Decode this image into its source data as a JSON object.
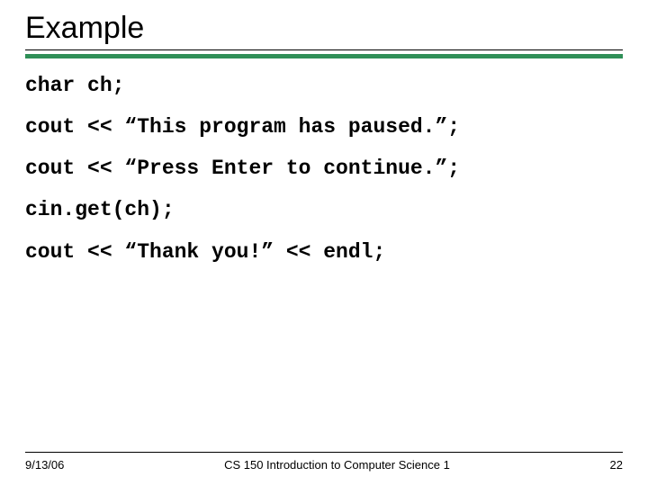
{
  "slide": {
    "title": "Example",
    "code_lines": [
      "char ch;",
      "cout << “This program has paused.”;",
      "cout << “Press Enter to continue.”;",
      "cin.get(ch);",
      "cout << “Thank you!” << endl;"
    ]
  },
  "footer": {
    "date": "9/13/06",
    "course": "CS 150 Introduction to Computer Science 1",
    "page": "22"
  }
}
